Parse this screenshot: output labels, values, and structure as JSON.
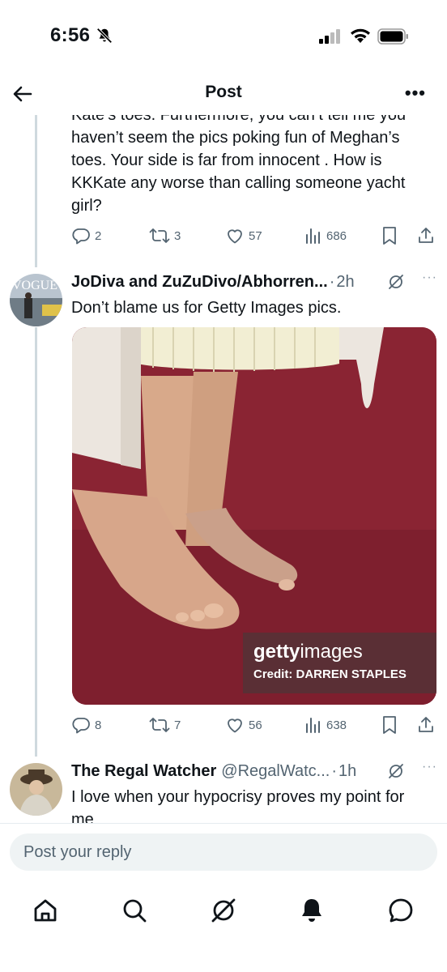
{
  "status": {
    "time": "6:56"
  },
  "header": {
    "title": "Post"
  },
  "tweets": [
    {
      "text": "Kate’s toes. Furthermore, you can’t tell me you haven’t  seem the pics poking fun of Meghan’s toes. Your side is far from innocent . How is KKKate any worse than calling someone yacht girl?",
      "replies": "2",
      "reposts": "3",
      "likes": "57",
      "views": "686"
    },
    {
      "author": "JoDiva and ZuZuDivo/Abhorren...",
      "time": "2h",
      "text": "Don’t blame us for Getty Images pics.",
      "avatar_text": "VOGUE",
      "media": {
        "watermark_brand_bold": "getty",
        "watermark_brand_light": "images",
        "credit": "Credit: DARREN STAPLES"
      },
      "replies": "8",
      "reposts": "7",
      "likes": "56",
      "views": "638"
    },
    {
      "author": "The Regal Watcher",
      "handle": "@RegalWatc...",
      "time": "1h",
      "text": "I love when your hypocrisy proves my point for me"
    }
  ],
  "reply": {
    "placeholder": "Post your reply"
  },
  "colors": {
    "accent": "#1d9bf0",
    "muted": "#536471",
    "carpet": "#8a2433"
  }
}
